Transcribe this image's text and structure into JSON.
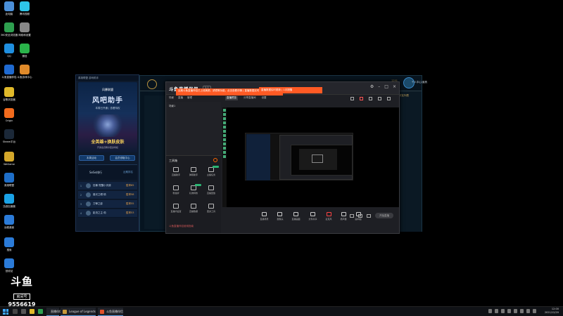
{
  "desktop": {
    "icons": [
      {
        "label": "此电脑",
        "icon": "computer-icon",
        "color": "#4a90d9"
      },
      {
        "label": "腾讯视频",
        "icon": "video-icon",
        "color": "#2ec5e8"
      },
      {
        "label": "360安全浏览器",
        "icon": "browser-icon",
        "color": "#2e9f4f"
      },
      {
        "label": "网络和设置",
        "icon": "network-icon",
        "color": "#888888"
      },
      {
        "label": "QQ",
        "icon": "qq-icon",
        "color": "#1f8fe0"
      },
      {
        "label": "微信",
        "icon": "wechat-icon",
        "color": "#2ab34a"
      },
      {
        "label": "斗鱼直播伴侣",
        "icon": "app-icon",
        "color": "#1f6ad0"
      },
      {
        "label": "斗鱼游戏中心",
        "icon": "game-icon",
        "color": "#e08a2a"
      },
      {
        "label": "谷歌浏览器",
        "icon": "chrome-icon",
        "color": "#e0b92a"
      },
      {
        "label": "Origin",
        "icon": "origin-icon",
        "color": "#f26b1d"
      },
      {
        "label": "Steam平台",
        "icon": "steam-icon",
        "color": "#1b2838"
      },
      {
        "label": "WeGame",
        "icon": "wegame-icon",
        "color": "#d4a72a"
      },
      {
        "label": "英雄联盟",
        "icon": "league-icon",
        "color": "#1e6ec8"
      },
      {
        "label": "迅游加速器",
        "icon": "cloud-icon",
        "color": "#1aa2e6"
      },
      {
        "label": "远程桌面",
        "icon": "remote-icon",
        "color": "#2b7bd8"
      },
      {
        "label": "搜索",
        "icon": "search-icon",
        "color": "#2b7bd8"
      },
      {
        "label": "回收站",
        "icon": "recycle-icon",
        "color": "#2b7bd8"
      }
    ]
  },
  "assistant": {
    "title": "英雄联盟 游戏助手",
    "brand": "风暴联盟",
    "headline": "风吧助手",
    "sub": "本周已开通 | 查看特权",
    "slogan": "全英雄+换肤皮肤",
    "tiny": "开通会员畅享更多特权",
    "btn_left": "本周活动",
    "btn_right": "会员领取中心",
    "panel_title": "SeSe排行",
    "panel_link": "近期排名",
    "rows": [
      {
        "rank": "1",
        "name": "狂暴·觉醒小天使",
        "score": "胜率65"
      },
      {
        "rank": "2",
        "name": "暮光之眼·慎",
        "score": "胜率58"
      },
      {
        "rank": "3",
        "name": "刀锋之影",
        "score": "胜率55"
      },
      {
        "rank": "4",
        "name": "影流之主·劫",
        "score": "胜率53"
      }
    ]
  },
  "lol": {
    "user_level": "1291",
    "user_name": "个人中心/道具",
    "right_title": "好友列表"
  },
  "douyu": {
    "logo": "斗鱼直播伴侣",
    "version": "5.0",
    "notice": "近期斗鱼直播伴侣已上线美颜、滤镜等功能，点击查看详情 | 直播数据实时更新",
    "notice2": "直播数据实时更新 | 1次提醒",
    "tabs": [
      "场景",
      "直播",
      "管理"
    ],
    "scene_label": "场景1",
    "subtabs": [
      "直播预览",
      "分享直播间",
      "设置"
    ],
    "tools_title": "工具箱",
    "tools": [
      "直播助手",
      "弹幕助手",
      "主播任务",
      "粉丝牌",
      "礼物特效",
      "直播回放",
      "直播间设置",
      "直播数据",
      "更多工具"
    ],
    "controls": [
      "直播场景",
      "摄像头",
      "直播画面",
      "文件共享",
      "麦克风",
      "扬声器",
      "画中画"
    ],
    "start_button": "开始直播",
    "bottom_hint": "斗鱼直播伴侣使用指南"
  },
  "watermark": {
    "logo": "斗鱼",
    "label": "房间号",
    "room": "9556619"
  },
  "taskbar": {
    "items": [
      {
        "label": "直播伴侣",
        "color": "#2b6fd0"
      },
      {
        "label": "League of Legends",
        "color": "#c79a3a"
      },
      {
        "label": "斗鱼直播伴侣",
        "color": "#e0502a"
      }
    ],
    "time": "12:00",
    "date": "2021/12/20"
  }
}
